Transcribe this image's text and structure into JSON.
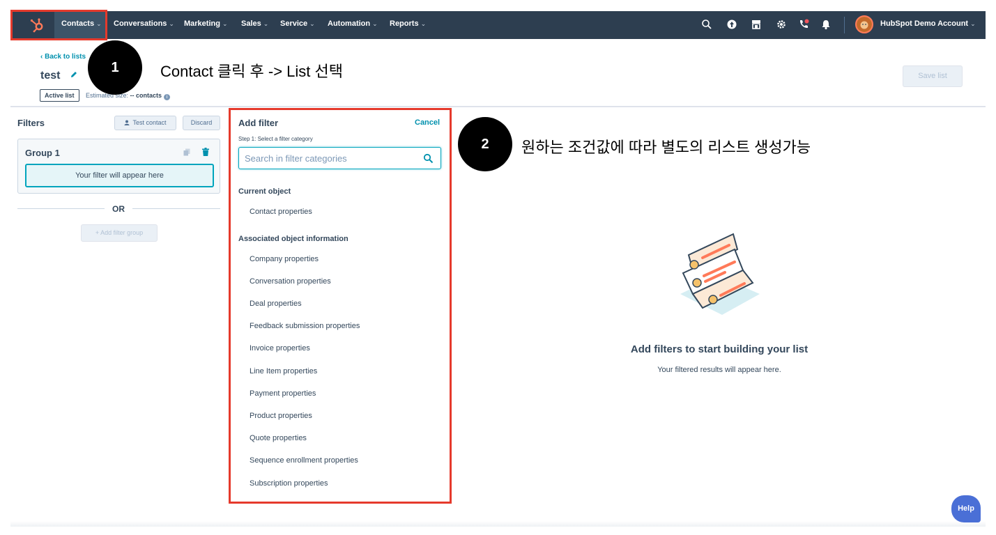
{
  "nav": {
    "items": [
      {
        "label": "Contacts"
      },
      {
        "label": "Conversations"
      },
      {
        "label": "Marketing"
      },
      {
        "label": "Sales"
      },
      {
        "label": "Service"
      },
      {
        "label": "Automation"
      },
      {
        "label": "Reports"
      }
    ],
    "chevron": "⌄",
    "icons": [
      "search-icon",
      "upgrade-icon",
      "marketplace-icon",
      "settings-icon",
      "calling-icon",
      "notifications-icon"
    ],
    "account_name": "HubSpot Demo Account"
  },
  "header": {
    "back_link": "‹  Back to lists",
    "list_name": "test",
    "list_type_badge": "Active list",
    "estimated_size_label": "Estimated size:",
    "estimated_size_value": "-- contacts",
    "save_button": "Save list"
  },
  "annotations": {
    "step1_number": "1",
    "step1_text": "Contact 클릭 후 -> List 선택",
    "step2_number": "2",
    "step2_text": "원하는 조건값에 따라 별도의 리스트 생성가능"
  },
  "filters": {
    "title": "Filters",
    "test_contact_button": "Test contact",
    "discard_button": "Discard",
    "group_title": "Group 1",
    "placeholder": "Your filter will appear here",
    "or_label": "OR",
    "add_group_button": "+ Add filter group"
  },
  "add_filter": {
    "title": "Add filter",
    "cancel": "Cancel",
    "step_label": "Step 1: Select a filter category",
    "search_placeholder": "Search in filter categories",
    "current_object_heading": "Current object",
    "current_object_items": [
      "Contact properties"
    ],
    "associated_heading": "Associated object information",
    "associated_items": [
      "Company properties",
      "Conversation properties",
      "Deal properties",
      "Feedback submission properties",
      "Invoice properties",
      "Line Item properties",
      "Payment properties",
      "Product properties",
      "Quote properties",
      "Sequence enrollment properties",
      "Subscription properties"
    ]
  },
  "empty_state": {
    "title": "Add filters to start building your list",
    "subtitle": "Your filtered results will appear here."
  },
  "help_button": "Help",
  "colors": {
    "nav_bg": "#2d3e50",
    "accent_teal": "#00a4bd",
    "link": "#0091ae",
    "highlight_red": "#e53a2c",
    "brand_orange": "#ff7a59"
  }
}
